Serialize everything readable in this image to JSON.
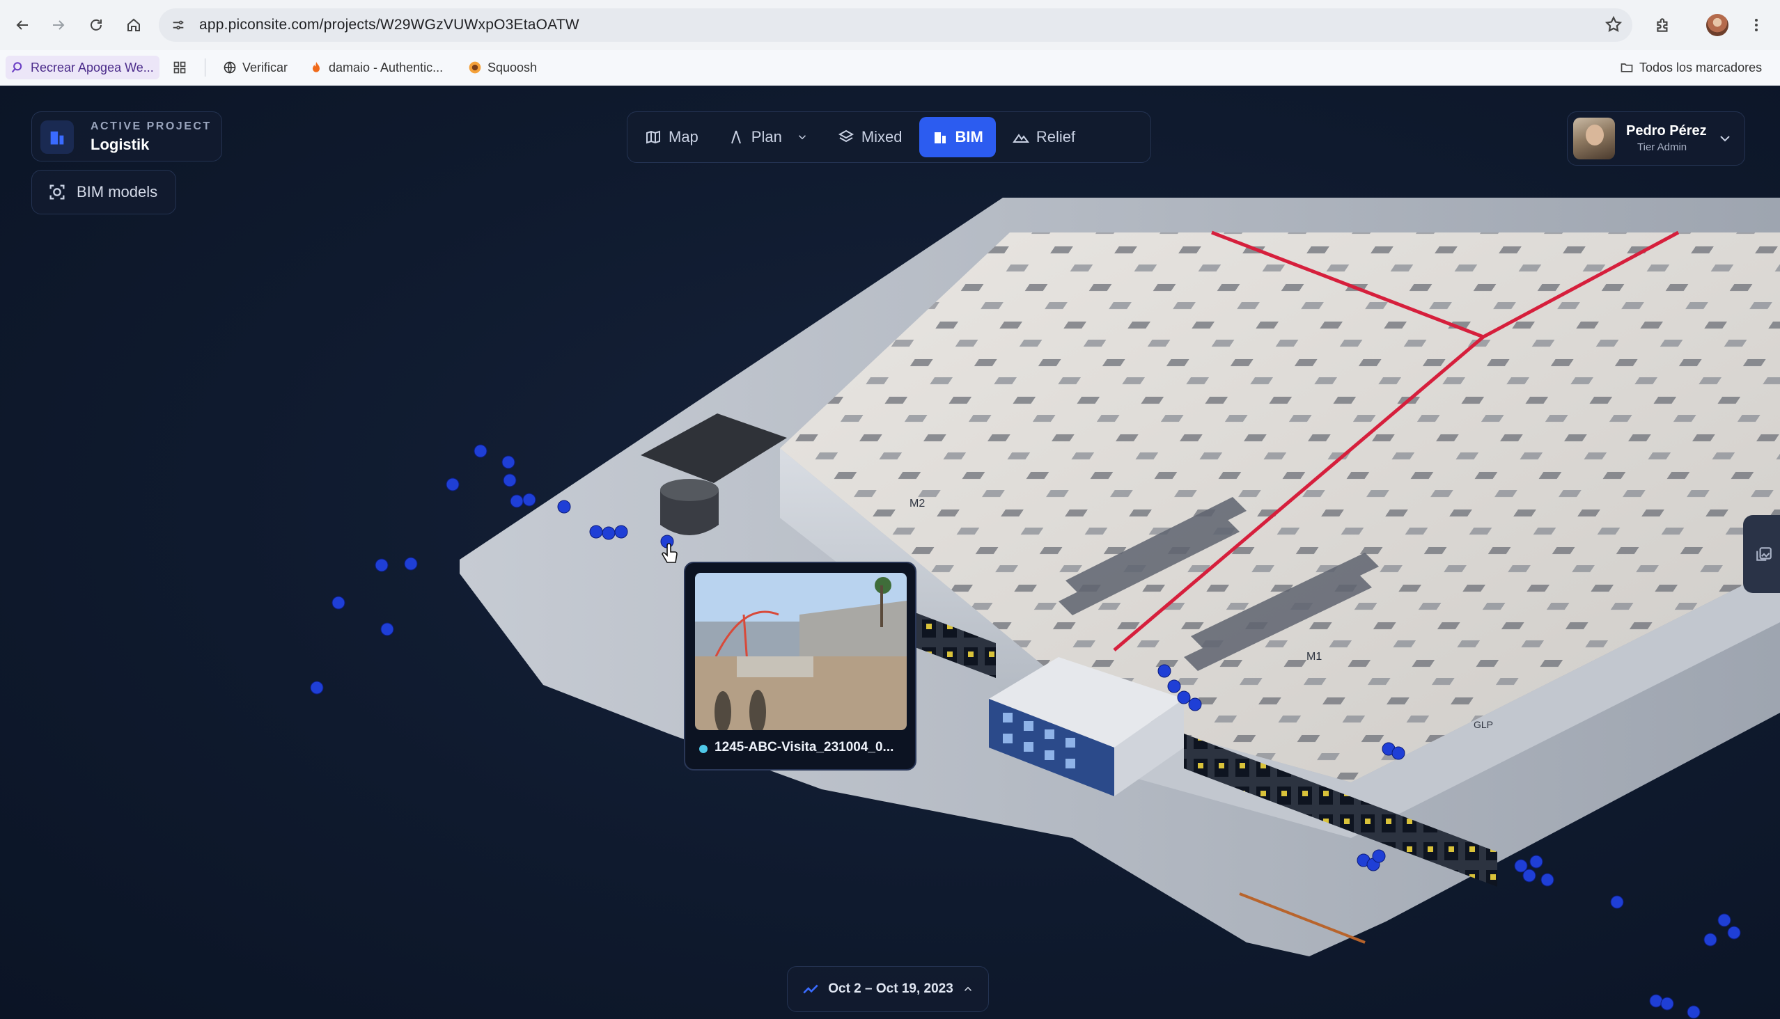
{
  "browser": {
    "url": "app.piconsite.com/projects/W29WGzVUWxpO3EtaOATW",
    "bookmarks": [
      {
        "label": "Recrear Apogea We...",
        "icon": "search-icon"
      },
      {
        "label": "Verificar",
        "icon": "globe-icon"
      },
      {
        "label": "damaio - Authentic...",
        "icon": "flame-icon"
      },
      {
        "label": "Squoosh",
        "icon": "squoosh-icon"
      }
    ],
    "all_bookmarks_label": "Todos los marcadores"
  },
  "project": {
    "eyebrow": "ACTIVE PROJECT",
    "name": "Logistik"
  },
  "bim_models_label": "BIM models",
  "view_tabs": [
    {
      "label": "Map",
      "icon": "map-icon",
      "active": false
    },
    {
      "label": "Plan",
      "icon": "plan-icon",
      "active": false,
      "has_dropdown": true
    },
    {
      "label": "Mixed",
      "icon": "layers-icon",
      "active": false
    },
    {
      "label": "BIM",
      "icon": "building-icon",
      "active": true
    },
    {
      "label": "Relief",
      "icon": "mountain-icon",
      "active": false
    }
  ],
  "user": {
    "name": "Pedro Pérez",
    "role": "Tier Admin"
  },
  "photo_popup": {
    "caption": "1245-ABC-Visita_231004_0..."
  },
  "scene_labels": {
    "m2": "M2",
    "m1": "M1",
    "glp": "GLP"
  },
  "timeline": {
    "range": "Oct 2 – Oct 19, 2023"
  },
  "colors": {
    "accent": "#2c5cf0",
    "background": "#0f1a2e",
    "marker": "#1f3fd6",
    "fire_line": "#d61f3c"
  }
}
